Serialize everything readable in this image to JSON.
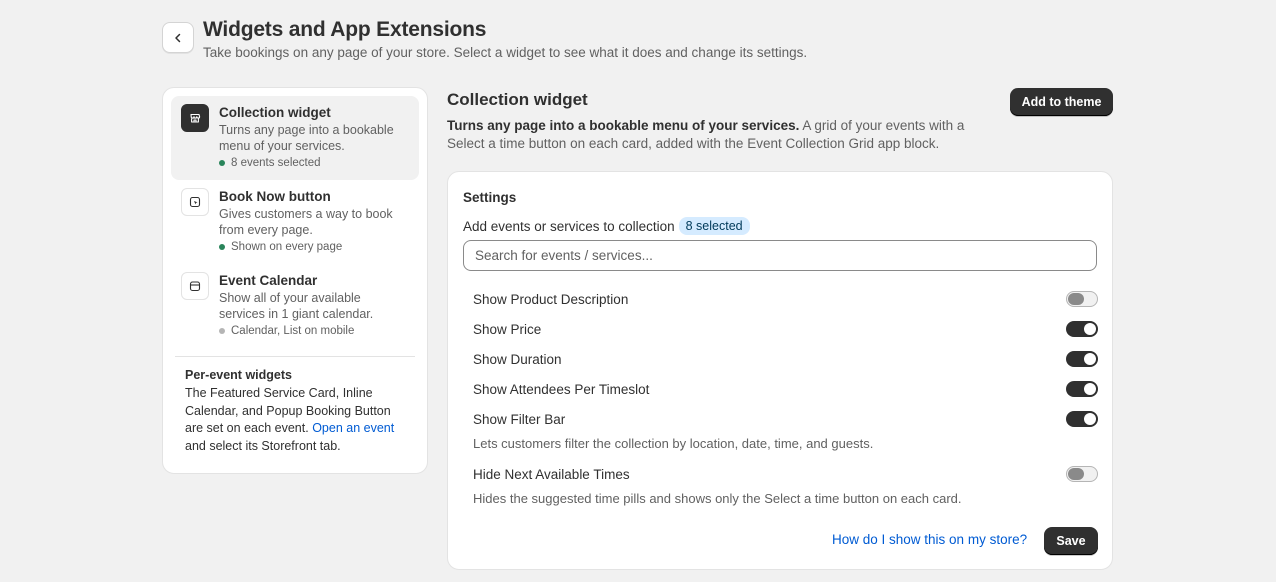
{
  "header": {
    "title": "Widgets and App Extensions",
    "subtitle": "Take bookings on any page of your store. Select a widget to see what it does and change its settings.",
    "back_icon": "chevron-left-icon"
  },
  "sidebar": {
    "items": [
      {
        "title": "Collection widget",
        "description": "Turns any page into a bookable menu of your services.",
        "status": "8 events selected",
        "status_color": "#29845a",
        "icon": "store-icon",
        "active": true
      },
      {
        "title": "Book Now button",
        "description": "Gives customers a way to book from every page.",
        "status": "Shown on every page",
        "status_color": "#29845a",
        "icon": "button-icon",
        "active": false
      },
      {
        "title": "Event Calendar",
        "description": "Show all of your available services in 1 giant calendar.",
        "status": "Calendar, List on mobile",
        "status_color": "#b5b5b5",
        "icon": "calendar-icon",
        "active": false
      }
    ],
    "per_event": {
      "title": "Per-event widgets",
      "text_before": "The Featured Service Card, Inline Calendar, and Popup Booking Button are set on each event.",
      "link": "Open an event",
      "text_after": "and select its Storefront tab."
    }
  },
  "main": {
    "title": "Collection widget",
    "add_to_theme_label": "Add to theme",
    "desc_bold": "Turns any page into a bookable menu of your services.",
    "desc_rest": "A grid of your events with a Select a time button on each card, added with the Event Collection Grid app block.",
    "settings": {
      "title": "Settings",
      "collection_label": "Add events or services to collection",
      "selected_badge": "8 selected",
      "search_placeholder": "Search for events / services...",
      "toggles": [
        {
          "label": "Show Product Description",
          "on": false
        },
        {
          "label": "Show Price",
          "on": true
        },
        {
          "label": "Show Duration",
          "on": true
        },
        {
          "label": "Show Attendees Per Timeslot",
          "on": true
        },
        {
          "label": "Show Filter Bar",
          "on": true,
          "help": "Lets customers filter the collection by location, date, time, and guests."
        },
        {
          "label": "Hide Next Available Times",
          "on": false,
          "help": "Hides the suggested time pills and shows only the Select a time button on each card."
        }
      ],
      "help_link": "How do I show this on my store?",
      "save_label": "Save"
    }
  },
  "colors": {
    "accent": "#303030",
    "link": "#005bd3",
    "badge_bg": "#d5ebff"
  }
}
